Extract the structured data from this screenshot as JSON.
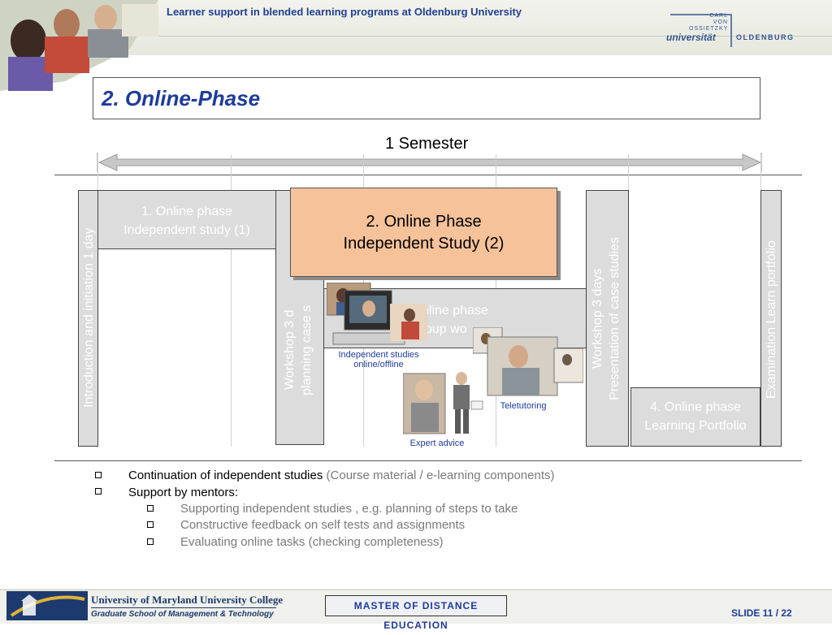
{
  "header": {
    "title": "Learner support in blended learning programs at Oldenburg University",
    "logo": {
      "line1": "CARL",
      "line2": "VON",
      "line3": "OSSIETZKY",
      "univ": "universität",
      "city": "OLDENBURG"
    }
  },
  "slide": {
    "title": "2. Online-Phase",
    "semester": "1 Semester"
  },
  "phases": {
    "intro": "Introduction and initiation  1 day",
    "phase1_line1": "1. Online phase",
    "phase1_line2": "Independent study (1)",
    "workshop1_line1": "Workshop 3 d",
    "workshop1_line2": "planning case s",
    "phase2_line1": "2. Online Phase",
    "phase2_line2": "Independent Study (2)",
    "group_line1": "nline phase",
    "group_line2": "oup wo",
    "workshop2_line1": "Workshop 3 days",
    "workshop2_line2": "Presentation of case studies",
    "phase4_line1": "4. Online phase",
    "phase4_line2": "Learning Portfolio",
    "exam": "Examination Learn portfolio"
  },
  "captions": {
    "independent_line1": "Independent studies",
    "independent_line2": "online/offline",
    "teletutoring": "Teletutoring",
    "expert": "Expert advice"
  },
  "bullets": {
    "b1_main": "Continuation of independent studies",
    "b1_grey": " (Course material / e-learning components)",
    "b2": "Support by mentors:",
    "sub1": "Supporting independent studies , e.g.  planning of steps to take",
    "sub2": "Constructive feedback on self tests and assignments",
    "sub3": "Evaluating online tasks (checking completeness)"
  },
  "footer": {
    "umuc_line1": "University of Maryland University College",
    "umuc_line2": "Graduate School of Management & Technology",
    "mde": "MASTER OF DISTANCE EDUCATION",
    "slide_number": "SLIDE 11 / 22"
  },
  "colors": {
    "accent_blue": "#1f3b9a",
    "orange_box": "#f6c29a",
    "grey_box": "#dcdcdc"
  }
}
